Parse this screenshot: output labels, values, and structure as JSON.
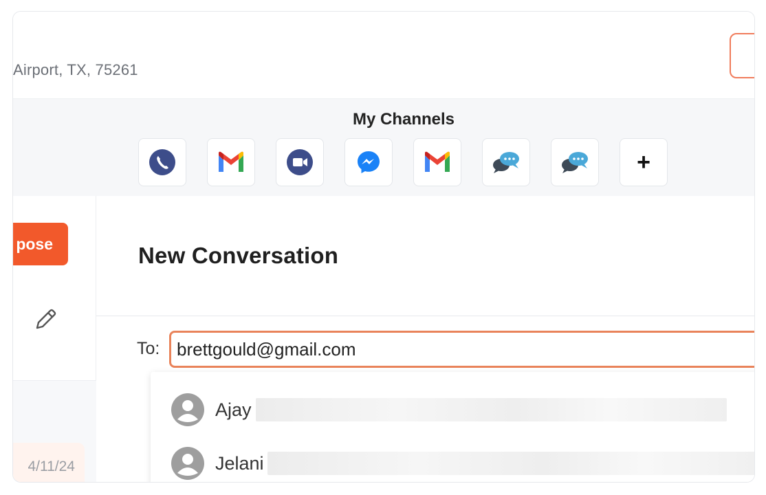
{
  "header": {
    "address_fragment": "Airport, TX, 75261"
  },
  "channels": {
    "title": "My Channels",
    "items": [
      {
        "icon": "phone-icon",
        "color": "#3d4d8a"
      },
      {
        "icon": "gmail-icon",
        "color": "#ea4335"
      },
      {
        "icon": "video-call-icon",
        "color": "#3d4d8a"
      },
      {
        "icon": "messenger-icon",
        "color": "#1a82f7"
      },
      {
        "icon": "gmail-icon",
        "color": "#ea4335"
      },
      {
        "icon": "chat-bubbles-icon",
        "color": "#4aa8d8"
      },
      {
        "icon": "chat-bubbles-icon",
        "color": "#4aa8d8"
      },
      {
        "icon": "add-icon",
        "glyph": "+"
      }
    ]
  },
  "left_pane": {
    "compose_label": "pose",
    "date": "4/11/24"
  },
  "main": {
    "title": "New Conversation",
    "to_label": "To:",
    "to_value": "brettgould@gmail.com"
  },
  "suggestions": [
    {
      "name": "Ajay"
    },
    {
      "name": "Jelani"
    }
  ],
  "colors": {
    "accent": "#f2592b",
    "input_border": "#e9835a"
  }
}
